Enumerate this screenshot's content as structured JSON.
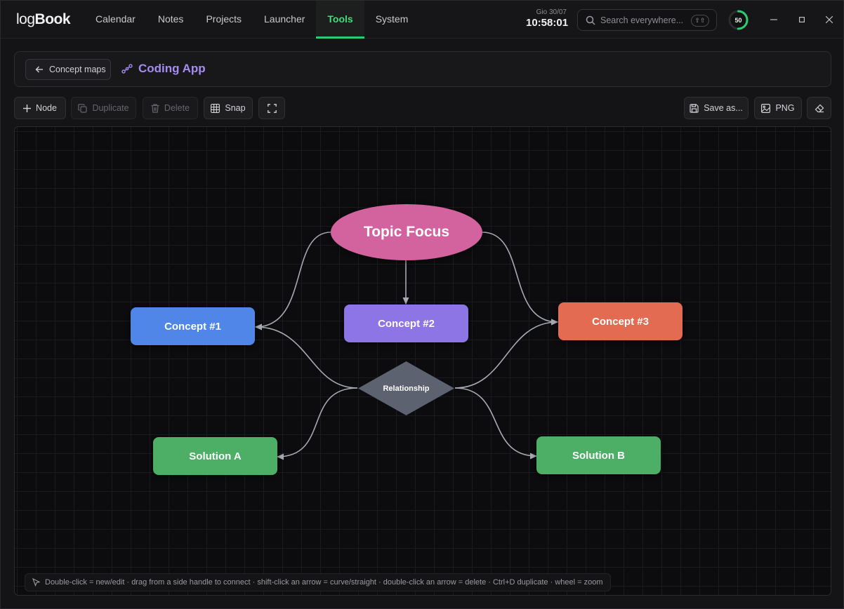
{
  "app": {
    "logo_light": "log",
    "logo_bold": "Book"
  },
  "nav": [
    {
      "label": "Calendar"
    },
    {
      "label": "Notes"
    },
    {
      "label": "Projects"
    },
    {
      "label": "Launcher"
    },
    {
      "label": "Tools",
      "active": true
    },
    {
      "label": "System"
    }
  ],
  "clock": {
    "date": "Gio 30/07",
    "time": "10:58:01"
  },
  "search": {
    "placeholder": "Search everywhere...",
    "shortcut": "⇧⇧"
  },
  "progress": {
    "value": 50,
    "percent": 0.5,
    "color": "#2ecc71"
  },
  "breadcrumb": {
    "back_label": "Concept maps",
    "title": "Coding App"
  },
  "toolbar": {
    "node_label": "Node",
    "duplicate_label": "Duplicate",
    "delete_label": "Delete",
    "snap_label": "Snap",
    "save_label": "Save as...",
    "png_label": "PNG"
  },
  "map": {
    "nodes": [
      {
        "id": "topic",
        "label": "Topic Focus",
        "shape": "ellipse",
        "color": "#d3639f"
      },
      {
        "id": "c1",
        "label": "Concept #1",
        "shape": "rect",
        "color": "#4f86e8"
      },
      {
        "id": "c2",
        "label": "Concept #2",
        "shape": "rect",
        "color": "#8e75e6"
      },
      {
        "id": "c3",
        "label": "Concept #3",
        "shape": "rect",
        "color": "#e36b52"
      },
      {
        "id": "rel",
        "label": "Relationship",
        "shape": "diamond",
        "color": "#5c6270"
      },
      {
        "id": "sa",
        "label": "Solution A",
        "shape": "rect",
        "color": "#4caf65"
      },
      {
        "id": "sb",
        "label": "Solution B",
        "shape": "rect",
        "color": "#4caf65"
      }
    ],
    "edges": [
      {
        "from": "topic",
        "to": "c1",
        "curve": true
      },
      {
        "from": "topic",
        "to": "c2",
        "curve": false
      },
      {
        "from": "topic",
        "to": "c3",
        "curve": true
      },
      {
        "from": "rel",
        "to": "c1",
        "curve": true
      },
      {
        "from": "rel",
        "to": "c3",
        "curve": true
      },
      {
        "from": "rel",
        "to": "sa",
        "curve": true
      },
      {
        "from": "rel",
        "to": "sb",
        "curve": true
      }
    ],
    "edge_color": "#a7aab3"
  },
  "hint": "Double-click = new/edit · drag from a side handle to connect · shift-click an arrow = curve/straight · double-click an arrow = delete · Ctrl+D duplicate · wheel = zoom"
}
